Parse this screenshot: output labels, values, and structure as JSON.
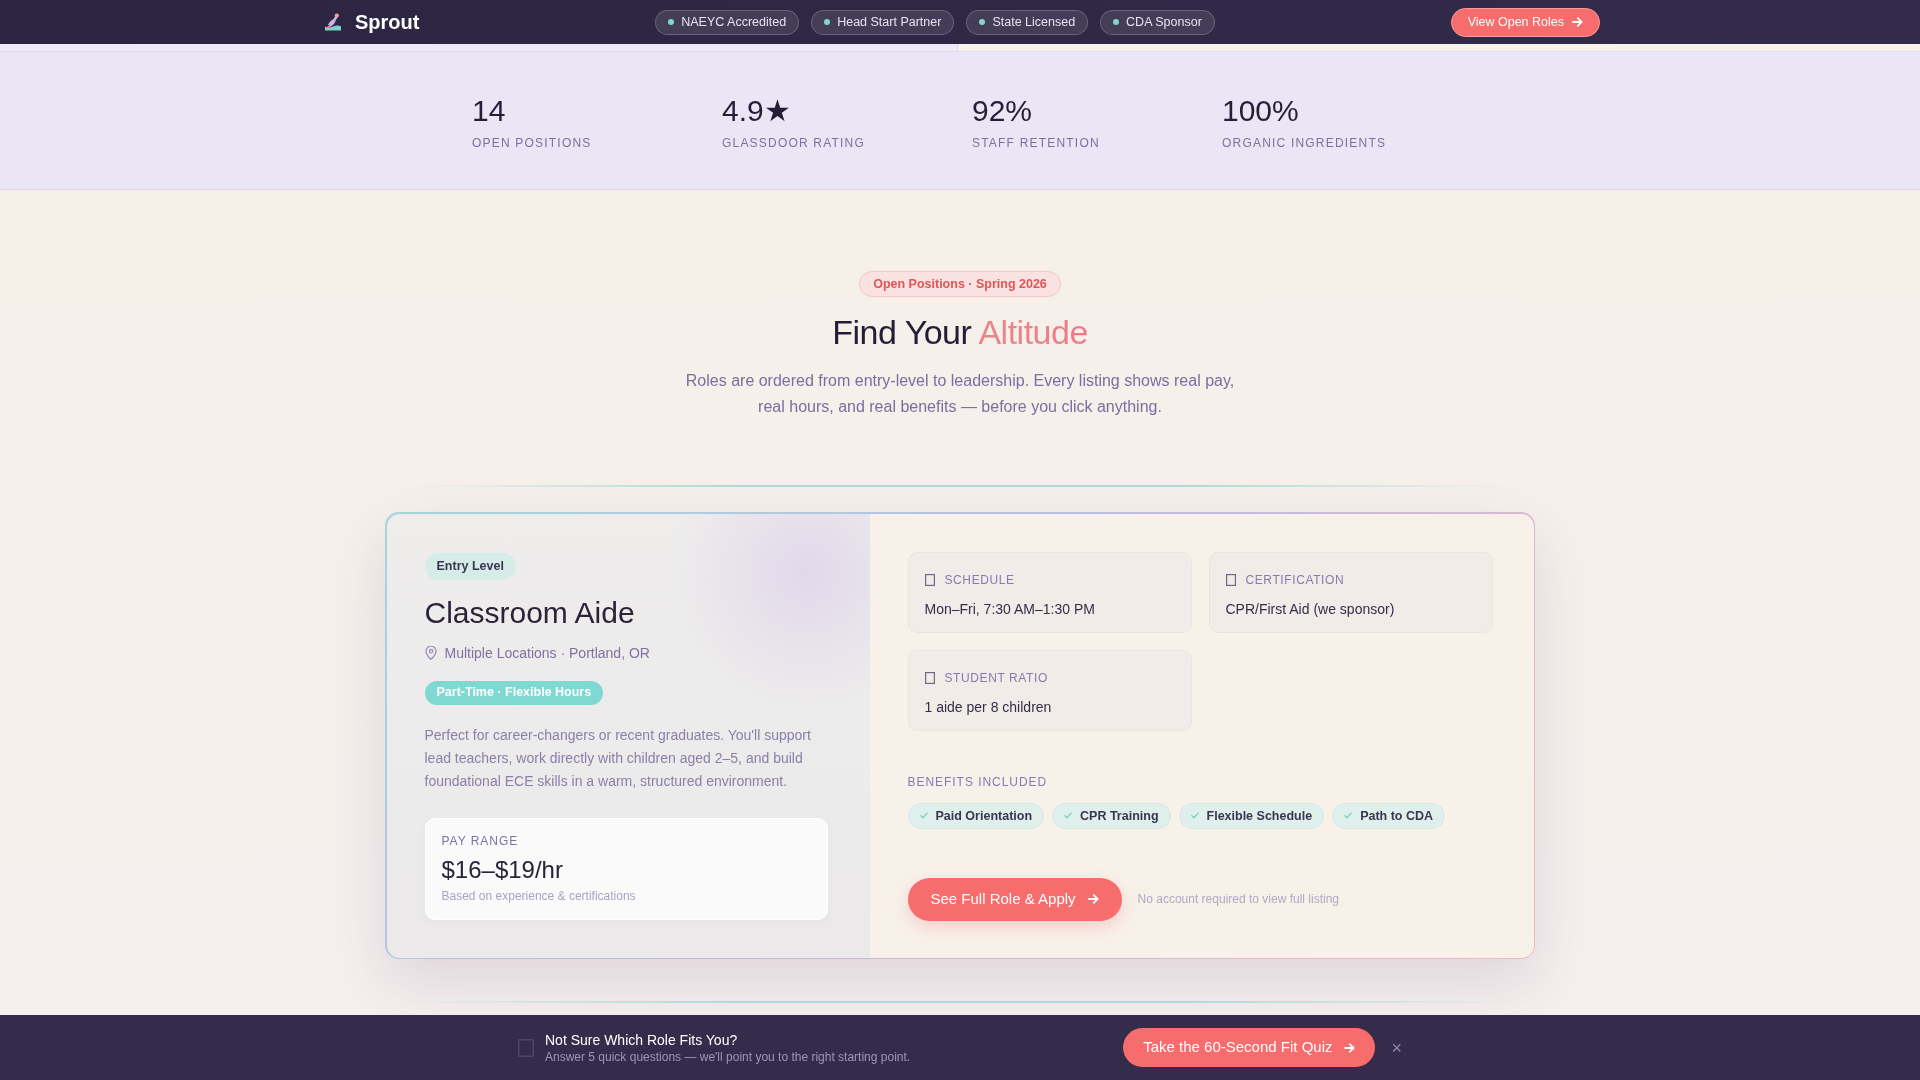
{
  "nav": {
    "brand": "Sprout",
    "badges": [
      "NAEYC Accredited",
      "Head Start Partner",
      "State Licensed",
      "CDA Sponsor"
    ],
    "cta": "View Open Roles"
  },
  "stats": [
    {
      "value": "14",
      "label": "OPEN POSITIONS"
    },
    {
      "value": "4.9★",
      "label": "GLASSDOOR RATING"
    },
    {
      "value": "92%",
      "label": "STAFF RETENTION"
    },
    {
      "value": "100%",
      "label": "ORGANIC INGREDIENTS"
    }
  ],
  "intro": {
    "eyebrow": "Open Positions · Spring 2026",
    "heading": [
      {
        "text": "Find Your",
        "accent": false
      },
      {
        "text": "Altitude",
        "accent": true
      }
    ],
    "description": "Roles are ordered from entry-level to leadership. Every listing shows real pay, real hours, and real benefits — before you click anything."
  },
  "role_card": {
    "level": "Entry Level",
    "title": "Classroom Aide",
    "location": "Multiple Locations · Portland, OR",
    "hours": "Part-Time · Flexible Hours",
    "description": "Perfect for career-changers or recent graduates. You'll support lead teachers, work directly with children aged 2–5, and build foundational ECE skills in a warm, structured environment.",
    "pay": {
      "label": "PAY RANGE",
      "value": "$16–$19/hr",
      "note": "Based on experience & certifications"
    },
    "details": [
      {
        "label": "SCHEDULE",
        "value": "Mon–Fri, 7:30 AM–1:30 PM"
      },
      {
        "label": "CERTIFICATION",
        "value": "CPR/First Aid (we sponsor)"
      },
      {
        "label": "STUDENT RATIO",
        "value": "1 aide per 8 children"
      }
    ],
    "benefits_title": "BENEFITS INCLUDED",
    "benefits": [
      "Paid Orientation",
      "CPR Training",
      "Flexible Schedule",
      "Path to CDA"
    ],
    "apply_button": "See Full Role & Apply",
    "apply_note": "No account required to view full listing"
  },
  "quiz_bar": {
    "title": "Not Sure Which Role Fits You?",
    "subtitle": "Answer 5 quick questions — we'll point you to the right starting point.",
    "button": "Take the 60-Second Fit Quiz",
    "close": "×"
  }
}
